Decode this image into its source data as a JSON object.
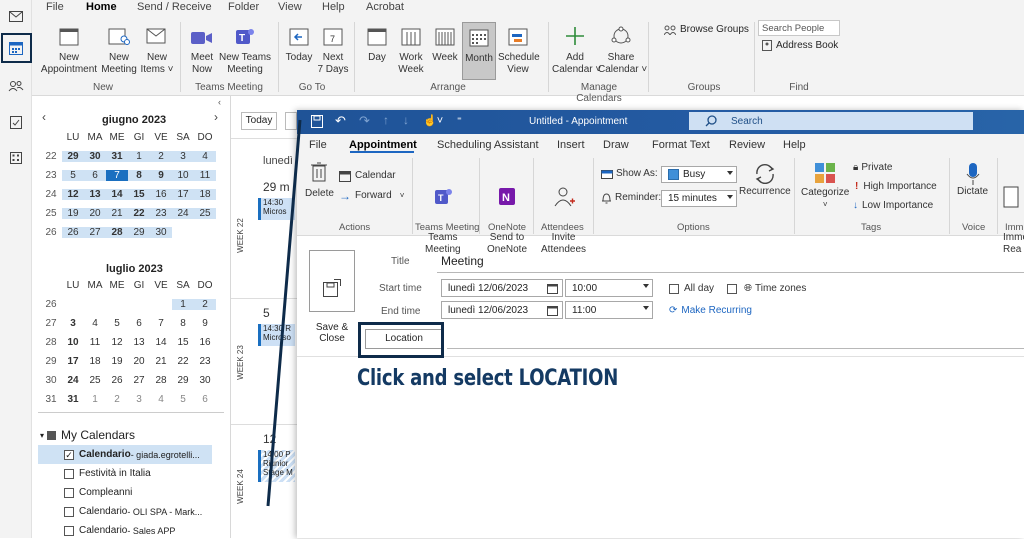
{
  "menu": {
    "tabs": [
      "File",
      "Home",
      "Send / Receive",
      "Folder",
      "View",
      "Help",
      "Acrobat"
    ],
    "active": "Home"
  },
  "ribbon": {
    "new_appointment": "New\nAppointment",
    "new_meeting": "New\nMeeting",
    "new_items": "New\nItems ˅",
    "group_new": "New",
    "meet_now": "Meet\nNow",
    "new_teams_meeting": "New Teams\nMeeting",
    "group_teams": "Teams Meeting",
    "today": "Today",
    "next7": "Next\n7 Days",
    "group_goto": "Go To",
    "day": "Day",
    "work_week": "Work\nWeek",
    "week": "Week",
    "month": "Month",
    "schedule_view": "Schedule\nView",
    "group_arrange": "Arrange",
    "add_calendar": "Add\nCalendar ˅",
    "share_calendar": "Share\nCalendar ˅",
    "group_manage": "Manage Calendars",
    "browse_groups": "Browse Groups",
    "group_groups": "Groups",
    "search_people": "Search People",
    "address_book": "Address Book",
    "group_find": "Find"
  },
  "navpane": {
    "june_title": "giugno 2023",
    "july_title": "luglio 2023",
    "weekday_headers": [
      "LU",
      "MA",
      "ME",
      "GI",
      "VE",
      "SA",
      "DO"
    ],
    "june_rows": [
      [
        "22",
        "29",
        "30",
        "31",
        "1",
        "2",
        "3",
        "4"
      ],
      [
        "23",
        "5",
        "6",
        "7",
        "8",
        "9",
        "10",
        "11"
      ],
      [
        "24",
        "12",
        "13",
        "14",
        "15",
        "16",
        "17",
        "18"
      ],
      [
        "25",
        "19",
        "20",
        "21",
        "22",
        "23",
        "24",
        "25"
      ],
      [
        "26",
        "26",
        "27",
        "28",
        "29",
        "30",
        "",
        ""
      ]
    ],
    "july_rows": [
      [
        "26",
        "",
        "",
        "",
        "",
        "",
        "1",
        "2"
      ],
      [
        "27",
        "3",
        "4",
        "5",
        "6",
        "7",
        "8",
        "9"
      ],
      [
        "28",
        "10",
        "11",
        "12",
        "13",
        "14",
        "15",
        "16"
      ],
      [
        "29",
        "17",
        "18",
        "19",
        "20",
        "21",
        "22",
        "23"
      ],
      [
        "30",
        "24",
        "25",
        "26",
        "27",
        "28",
        "29",
        "30"
      ],
      [
        "31",
        "31",
        "1",
        "2",
        "3",
        "4",
        "5",
        "6"
      ]
    ],
    "my_calendars": "My Calendars",
    "calendars": [
      {
        "name": "Calendario",
        "detail": " - giada.egrotelli...",
        "checked": true
      },
      {
        "name": "Festività in Italia",
        "detail": "",
        "checked": false
      },
      {
        "name": "Compleanni",
        "detail": "",
        "checked": false
      },
      {
        "name": "Calendario",
        "detail": " - OLI SPA - Mark...",
        "checked": false
      },
      {
        "name": "Calendario",
        "detail": " - Sales APP",
        "checked": false
      }
    ]
  },
  "calview": {
    "today_btn": "Today",
    "day_header": "lunedì",
    "dates": [
      "29 m",
      "5",
      "12"
    ],
    "weeks": [
      "WEEK 22",
      "WEEK 23",
      "WEEK 24"
    ],
    "events": [
      "14:30\nMicros",
      "14:30 R\nMicroso",
      "14:00 P\nRiunior\nStage M"
    ]
  },
  "appointment": {
    "window_title": "Untitled - Appointment",
    "search_placeholder": "Search",
    "tabs": [
      "File",
      "Appointment",
      "Scheduling Assistant",
      "Insert",
      "Draw",
      "Format Text",
      "Review",
      "Help"
    ],
    "active_tab": "Appointment",
    "delete": "Delete",
    "calendar": "Calendar",
    "forward": "Forward",
    "group_actions": "Actions",
    "teams_meeting": "Teams\nMeeting",
    "group_teams": "Teams Meeting",
    "send_onenote": "Send to\nOneNote",
    "group_onenote": "OneNote",
    "invite_attendees": "Invite\nAttendees",
    "group_attendees": "Attendees",
    "show_as_label": "Show As:",
    "show_as_value": "Busy",
    "reminder_label": "Reminder:",
    "reminder_value": "15 minutes",
    "recurrence": "Recurrence",
    "group_options": "Options",
    "categorize": "Categorize",
    "private": "Private",
    "high_importance": "High Importance",
    "low_importance": "Low Importance",
    "group_tags": "Tags",
    "dictate": "Dictate",
    "group_voice": "Voice",
    "immersive": "Imme\nRea",
    "group_immersive": "Imm",
    "save_close": "Save &\nClose",
    "title_label": "Title",
    "title_value": "Meeting",
    "start_label": "Start time",
    "start_date": "lunedì 12/06/2023",
    "start_time": "10:00",
    "end_label": "End time",
    "end_date": "lunedì 12/06/2023",
    "end_time": "11:00",
    "all_day": "All day",
    "time_zones": "Time zones",
    "make_recurring": "Make Recurring",
    "location_btn": "Location"
  },
  "annotation": {
    "caption": "Click and select LOCATION",
    "color": "#0e2b4a"
  }
}
